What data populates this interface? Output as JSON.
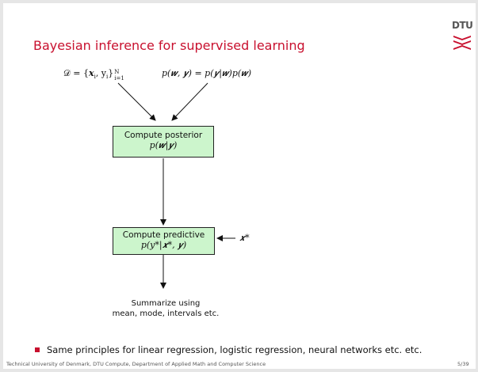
{
  "slide": {
    "title": "Bayesian inference for supervised learning",
    "logo_text": "DTU"
  },
  "diagram": {
    "input_data": "𝒟 = {",
    "input_data_b": "𝒙",
    "input_data_c": "i",
    "input_data_d": ", y",
    "input_data_e": "i",
    "input_data_f": "}",
    "input_data_sup": "N",
    "input_data_sub": "i=1",
    "joint": "p(𝒘, 𝒚) = p(𝒚|𝒘)p(𝒘)",
    "box1_line1": "Compute posterior",
    "box1_line2": "p(𝒘|𝒚)",
    "box2_line1": "Compute predictive",
    "box2_line2": "p(y*|𝒙*, 𝒚)",
    "new_input": "𝒙*",
    "summary_line1": "Summarize using",
    "summary_line2": "mean, mode, intervals etc."
  },
  "bullet": {
    "text": "Same principles for linear regression, logistic regression, neural networks etc. etc."
  },
  "footer": {
    "institution": "Technical University of Denmark, DTU Compute, Department of Applied Math and Computer Science",
    "page": "5/39"
  },
  "colors": {
    "title": "#c8102e",
    "box_fill": "#ccf5cc",
    "bullet": "#c8102e",
    "logo": "#c8102e"
  }
}
